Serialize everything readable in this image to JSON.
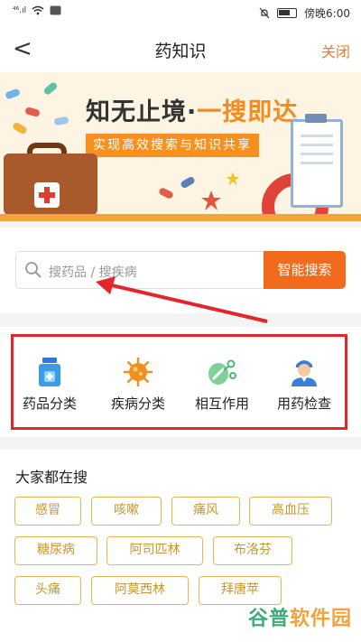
{
  "status_bar": {
    "signal": "⁴⁶.ıl",
    "time": "傍晚6:00"
  },
  "nav": {
    "back_glyph": "<",
    "title": "药知识",
    "close_label": "关闭"
  },
  "banner": {
    "title_main": "知无止境·",
    "title_accent": "一搜即达",
    "subtitle": "实现高效搜索与知识共享"
  },
  "search": {
    "placeholder": "搜药品 / 搜疾病",
    "button_label": "智能搜索"
  },
  "categories": [
    {
      "label": "药品分类",
      "icon": "medicine-bottle-icon"
    },
    {
      "label": "疾病分类",
      "icon": "virus-icon"
    },
    {
      "label": "相互作用",
      "icon": "interaction-icon"
    },
    {
      "label": "用药检查",
      "icon": "doctor-icon"
    }
  ],
  "popular": {
    "title": "大家都在搜",
    "tags": [
      "感冒",
      "咳嗽",
      "痛风",
      "高血压",
      "糖尿病",
      "阿司匹林",
      "布洛芬",
      "头痛",
      "阿莫西林",
      "拜唐苹"
    ]
  },
  "watermark": {
    "part1": "谷普",
    "part2": "软件园"
  },
  "colors": {
    "accent": "#f26a1b",
    "tag_border": "#e8b651",
    "annotation": "#e3262b"
  }
}
